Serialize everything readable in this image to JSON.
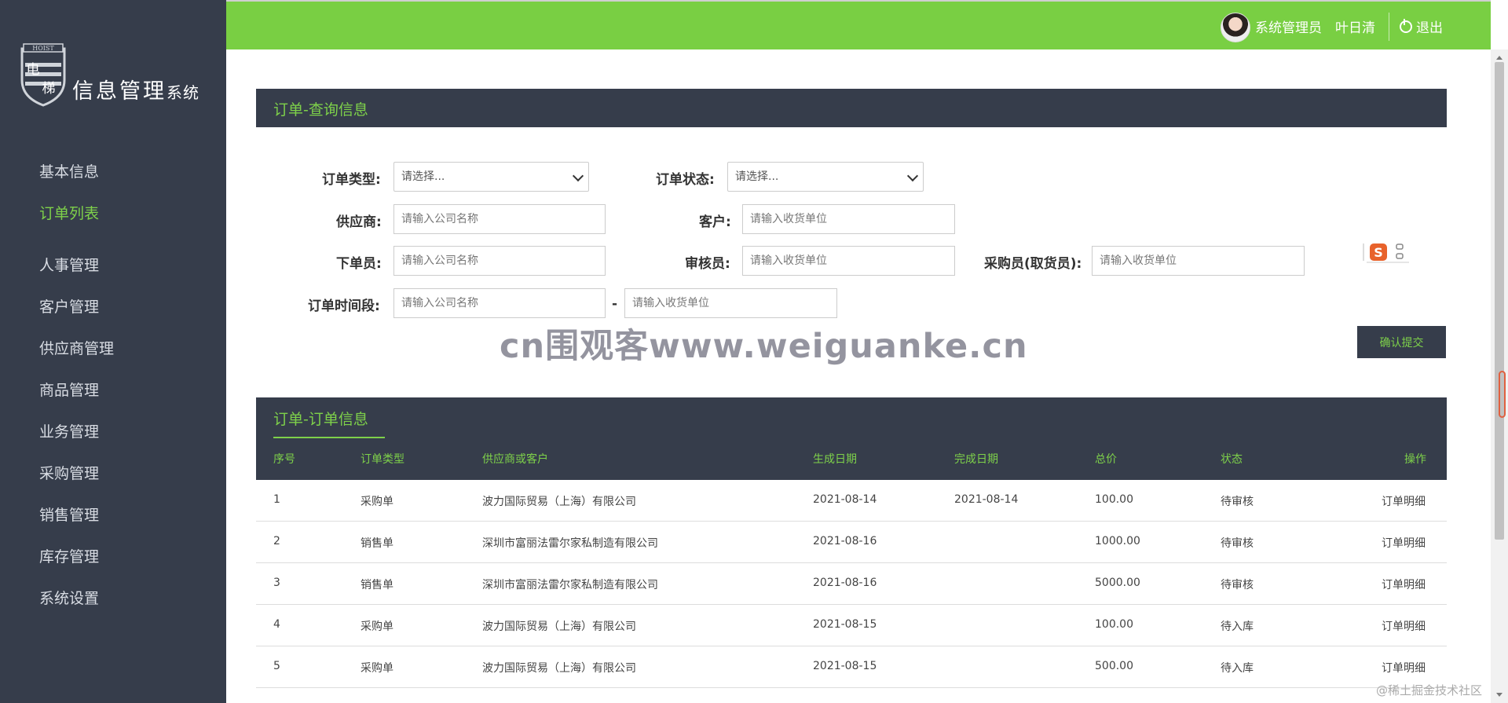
{
  "brand": {
    "emblem_chars": [
      "电",
      "梯"
    ],
    "emblem_ribbon": "HOIST",
    "name_main": "信息管理",
    "name_small": "系统"
  },
  "sidebar": {
    "items": [
      {
        "label": "基本信息",
        "active": false
      },
      {
        "label": "订单列表",
        "active": true
      },
      {
        "label": "人事管理",
        "active": false
      },
      {
        "label": "客户管理",
        "active": false
      },
      {
        "label": "供应商管理",
        "active": false
      },
      {
        "label": "商品管理",
        "active": false
      },
      {
        "label": "业务管理",
        "active": false
      },
      {
        "label": "采购管理",
        "active": false
      },
      {
        "label": "销售管理",
        "active": false
      },
      {
        "label": "库存管理",
        "active": false
      },
      {
        "label": "系统设置",
        "active": false
      }
    ]
  },
  "topbar": {
    "role": "系统管理员",
    "user": "叶日清",
    "logout": "退出",
    "accent": "#79cf43"
  },
  "query_panel": {
    "title": "订单-查询信息",
    "order_type_label": "订单类型:",
    "order_type_value": "请选择...",
    "order_status_label": "订单状态:",
    "order_status_value": "请选择...",
    "supplier_label": "供应商:",
    "supplier_placeholder": "请输入公司名称",
    "customer_label": "客户:",
    "customer_placeholder": "请输入收货单位",
    "orderer_label": "下单员:",
    "orderer_placeholder": "请输入公司名称",
    "reviewer_label": "审核员:",
    "reviewer_placeholder": "请输入收货单位",
    "buyer_label": "采购员(取货员):",
    "buyer_placeholder": "请输入收货单位",
    "time_label": "订单时间段:",
    "time_start_placeholder": "请输入公司名称",
    "time_separator": "-",
    "time_end_placeholder": "请输入收货单位",
    "submit_label": "确认提交"
  },
  "watermark": "cn围观客www.weiguanke.cn",
  "orders_panel": {
    "title": "订单-订单信息",
    "columns": [
      "序号",
      "订单类型",
      "供应商或客户",
      "生成日期",
      "完成日期",
      "总价",
      "状态",
      "操作"
    ],
    "rows": [
      {
        "no": "1",
        "type": "采购单",
        "party": "波力国际贸易（上海）有限公司",
        "created": "2021-08-14",
        "completed": "2021-08-14",
        "total": "100.00",
        "status": "待审核",
        "action": "订单明细"
      },
      {
        "no": "2",
        "type": "销售单",
        "party": "深圳市富丽法雷尔家私制造有限公司",
        "created": "2021-08-16",
        "completed": "",
        "total": "1000.00",
        "status": "待审核",
        "action": "订单明细"
      },
      {
        "no": "3",
        "type": "销售单",
        "party": "深圳市富丽法雷尔家私制造有限公司",
        "created": "2021-08-16",
        "completed": "",
        "total": "5000.00",
        "status": "待审核",
        "action": "订单明细"
      },
      {
        "no": "4",
        "type": "采购单",
        "party": "波力国际贸易（上海）有限公司",
        "created": "2021-08-15",
        "completed": "",
        "total": "100.00",
        "status": "待入库",
        "action": "订单明细"
      },
      {
        "no": "5",
        "type": "采购单",
        "party": "波力国际贸易（上海）有限公司",
        "created": "2021-08-15",
        "completed": "",
        "total": "500.00",
        "status": "待入库",
        "action": "订单明细"
      }
    ]
  },
  "footer_mark": "@稀土掘金技术社区",
  "ime": {
    "label": "S"
  }
}
